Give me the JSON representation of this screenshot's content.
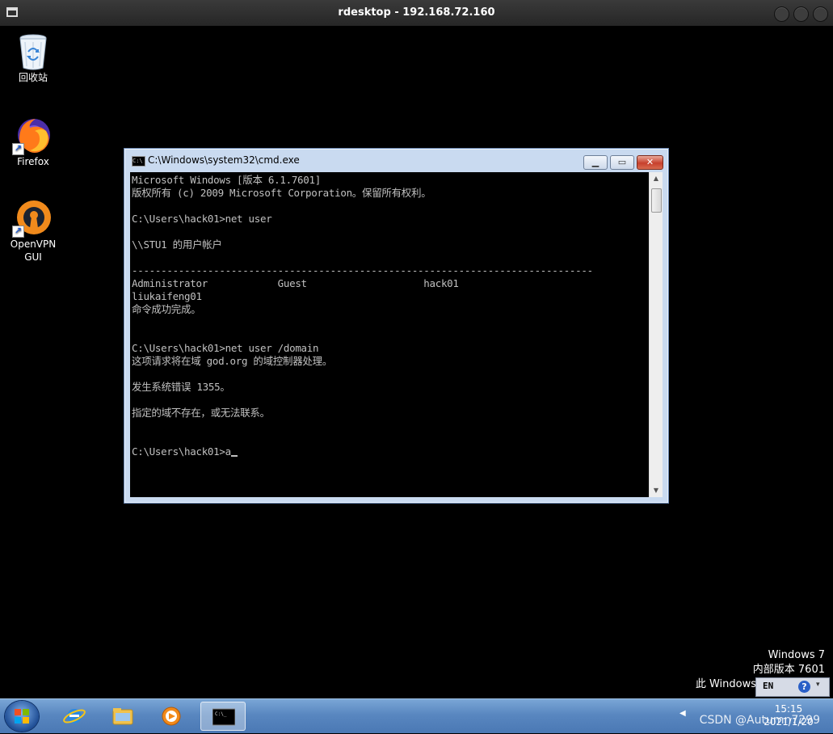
{
  "outer_window": {
    "title": "rdesktop - 192.168.72.160"
  },
  "desktop_icons": [
    {
      "label": "回收站",
      "icon": "recycle-bin-icon"
    },
    {
      "label": "Firefox",
      "icon": "firefox-icon"
    },
    {
      "label": "OpenVPN\nGUI",
      "icon": "openvpn-icon"
    }
  ],
  "cmd_window": {
    "title": "C:\\Windows\\system32\\cmd.exe",
    "console_text": "Microsoft Windows [版本 6.1.7601]\n版权所有 (c) 2009 Microsoft Corporation。保留所有权利。\n\nC:\\Users\\hack01>net user\n\n\\\\STU1 的用户帐户\n\n-------------------------------------------------------------------------------\nAdministrator            Guest                    hack01\nliukaifeng01\n命令成功完成。\n\n\nC:\\Users\\hack01>net user /domain\n这项请求将在域 god.org 的域控制器处理。\n\n发生系统错误 1355。\n\n指定的域不存在，或无法联系。\n\n\nC:\\Users\\hack01>a"
  },
  "watermark": {
    "line1": "Windows 7",
    "line2": "内部版本 7601",
    "line3": "此 Windows"
  },
  "language_bar": {
    "lang": "EN",
    "help": "?"
  },
  "taskbar": {
    "items": [
      {
        "name": "internet-explorer-icon"
      },
      {
        "name": "file-explorer-icon"
      },
      {
        "name": "media-player-icon"
      },
      {
        "name": "cmd-icon",
        "active": true
      }
    ],
    "time": "15:15",
    "date": "2021/1/20",
    "csdn_watermark": "CSDN @Autumn7299"
  },
  "colors": {
    "console_text": "#c0c0c0",
    "console_bg": "#000000",
    "window_frame": "#c9daf0",
    "taskbar": "#5987c0"
  }
}
